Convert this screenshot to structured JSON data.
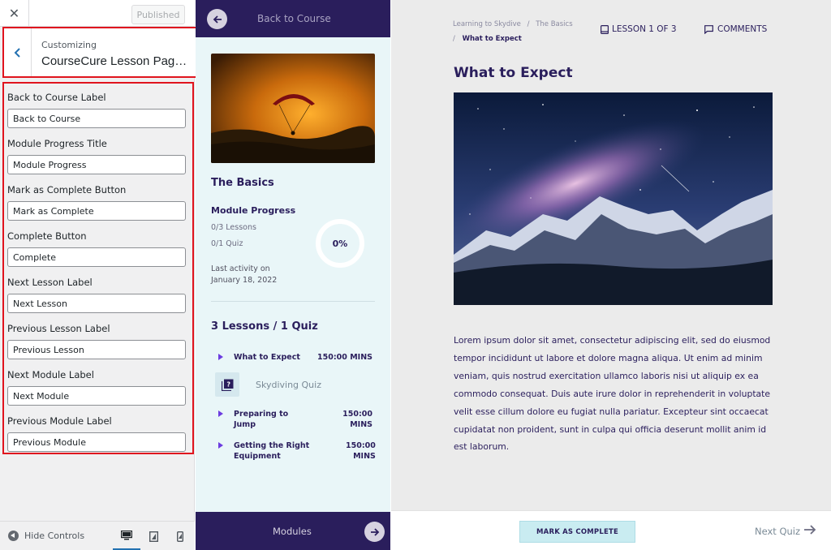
{
  "customizer": {
    "close_glyph": "✕",
    "published_label": "Published",
    "customizing_label": "Customizing",
    "customizing_title": "CourseCure Lesson Page ...",
    "fields": [
      {
        "label": "Back to Course Label",
        "value": "Back to Course"
      },
      {
        "label": "Module Progress Title",
        "value": "Module Progress"
      },
      {
        "label": "Mark as Complete Button",
        "value": "Mark as Complete"
      },
      {
        "label": "Complete Button",
        "value": "Complete"
      },
      {
        "label": "Next Lesson Label",
        "value": "Next Lesson"
      },
      {
        "label": "Previous Lesson Label",
        "value": "Previous Lesson"
      },
      {
        "label": "Next Module Label",
        "value": "Next Module"
      },
      {
        "label": "Previous Module Label",
        "value": "Previous Module"
      }
    ],
    "footer": {
      "hide_controls": "Hide Controls",
      "devices": [
        "desktop-icon",
        "tablet-icon",
        "mobile-icon"
      ]
    }
  },
  "course_sidebar": {
    "back_label": "Back to Course",
    "module_title": "The Basics",
    "progress_title": "Module Progress",
    "lessons_count": "0/3 Lessons",
    "quiz_count": "0/1 Quiz",
    "progress_percent": "0%",
    "progress_value": 0,
    "last_activity_label": "Last activity on",
    "last_activity_date": "January 18, 2022",
    "lessons_heading": "3 Lessons / 1 Quiz",
    "lessons": [
      {
        "name": "What to Expect",
        "duration": "150:00 MINS"
      },
      {
        "name": "Preparing to Jump",
        "duration": "150:00 MINS"
      },
      {
        "name": "Getting the Right Equipment",
        "duration": "150:00 MINS"
      }
    ],
    "quiz": {
      "name": "Skydiving Quiz",
      "icon": "quiz-icon"
    },
    "footer_label": "Modules",
    "accent_color": "#2a1e5c"
  },
  "lesson": {
    "breadcrumb": {
      "course": "Learning to Skydive",
      "module": "The Basics",
      "current": "What to Expect",
      "sep": "/"
    },
    "counter": "LESSON 1 OF 3",
    "comments": "COMMENTS",
    "title": "What to Expect",
    "body": "Lorem ipsum dolor sit amet, consectetur adipiscing elit, sed do eiusmod tempor incididunt ut labore et dolore magna aliqua. Ut enim ad minim veniam, quis nostrud exercitation ullamco laboris nisi ut aliquip ex ea commodo consequat. Duis aute irure dolor in reprehenderit in voluptate velit esse cillum dolore eu fugiat nulla pariatur. Excepteur sint occaecat cupidatat non proident, sunt in culpa qui officia deserunt mollit anim id est laborum.",
    "mark_complete": "MARK AS COMPLETE",
    "next_label": "Next Quiz"
  }
}
